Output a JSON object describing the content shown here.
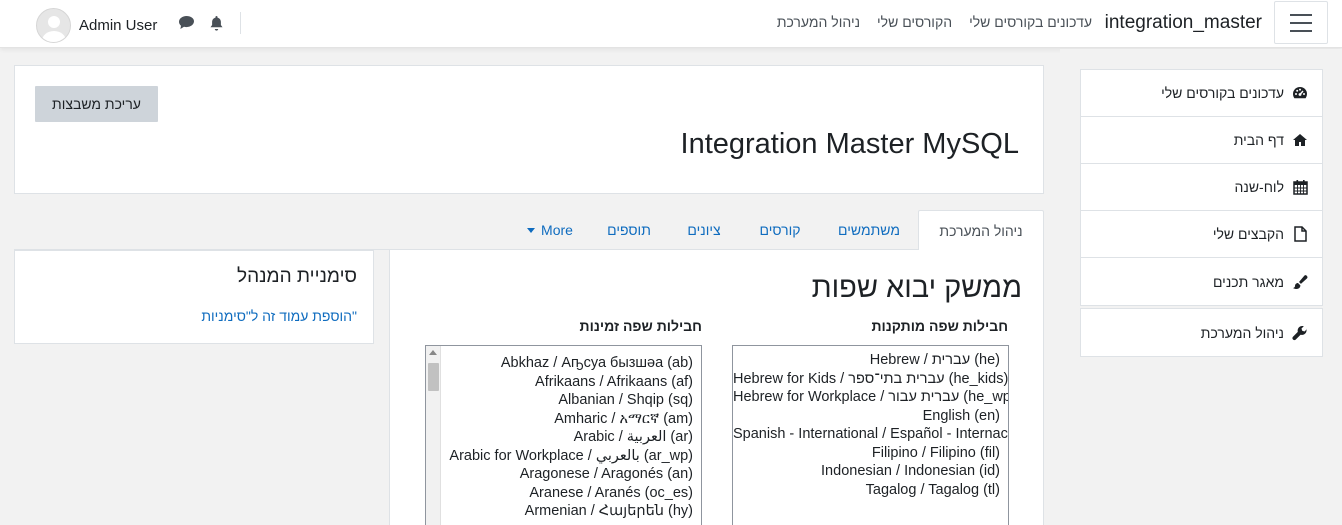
{
  "navbar": {
    "site_name": "integration_master",
    "links": [
      "עדכונים בקורסים שלי",
      "הקורסים שלי",
      "ניהול המערכת"
    ],
    "username": "Admin User"
  },
  "drawer": {
    "items": [
      {
        "label": "עדכונים בקורסים שלי",
        "icon": "dashboard-icon"
      },
      {
        "label": "דף הבית",
        "icon": "home-icon"
      },
      {
        "label": "לוח-שנה",
        "icon": "calendar-icon"
      },
      {
        "label": "הקבצים שלי",
        "icon": "file-icon"
      },
      {
        "label": "מאגר תכנים",
        "icon": "paintbrush-icon"
      }
    ],
    "admin_item": {
      "label": "ניהול המערכת",
      "icon": "wrench-icon"
    }
  },
  "header": {
    "edit_blocks_label": "עריכת משבצות",
    "course_title": "Integration Master MySQL"
  },
  "tabs": [
    "ניהול המערכת",
    "משתמשים",
    "קורסים",
    "ציונים",
    "תוספים",
    "More"
  ],
  "main": {
    "heading": "ממשק יבוא שפות",
    "installed_label": "חבילות שפה מותקנות",
    "available_label": "חבילות שפה זמינות",
    "installed_packs": [
      "Hebrew / עברית (he)",
      "Hebrew for Kids / עברית בתי־ספר (he_kids)",
      "Hebrew for Workplace / עברית עבור (he_wp)",
      "English (en)",
      "Spanish - International / Español - Internacional (es)",
      "Filipino / Filipino (fil)",
      "Indonesian / Indonesian (id)",
      "Tagalog / Tagalog (tl)"
    ],
    "available_packs": [
      "Abkhaz / Аҧсуа бызшәа (ab)",
      "Afrikaans / Afrikaans (af)",
      "Albanian / Shqip (sq)",
      "Amharic / አማርኛ (am)",
      "Arabic / العربية (ar)",
      "Arabic for Workplace / بالعربي (ar_wp)",
      "Aragonese / Aragonés (an)",
      "Aranese / Aranés (oc_es)",
      "Armenian / Հայերեն (hy)"
    ]
  },
  "bookmarks_block": {
    "title": "סימניית המנהל",
    "link": "הוספת עמוד זה ל\"סימניות\""
  }
}
